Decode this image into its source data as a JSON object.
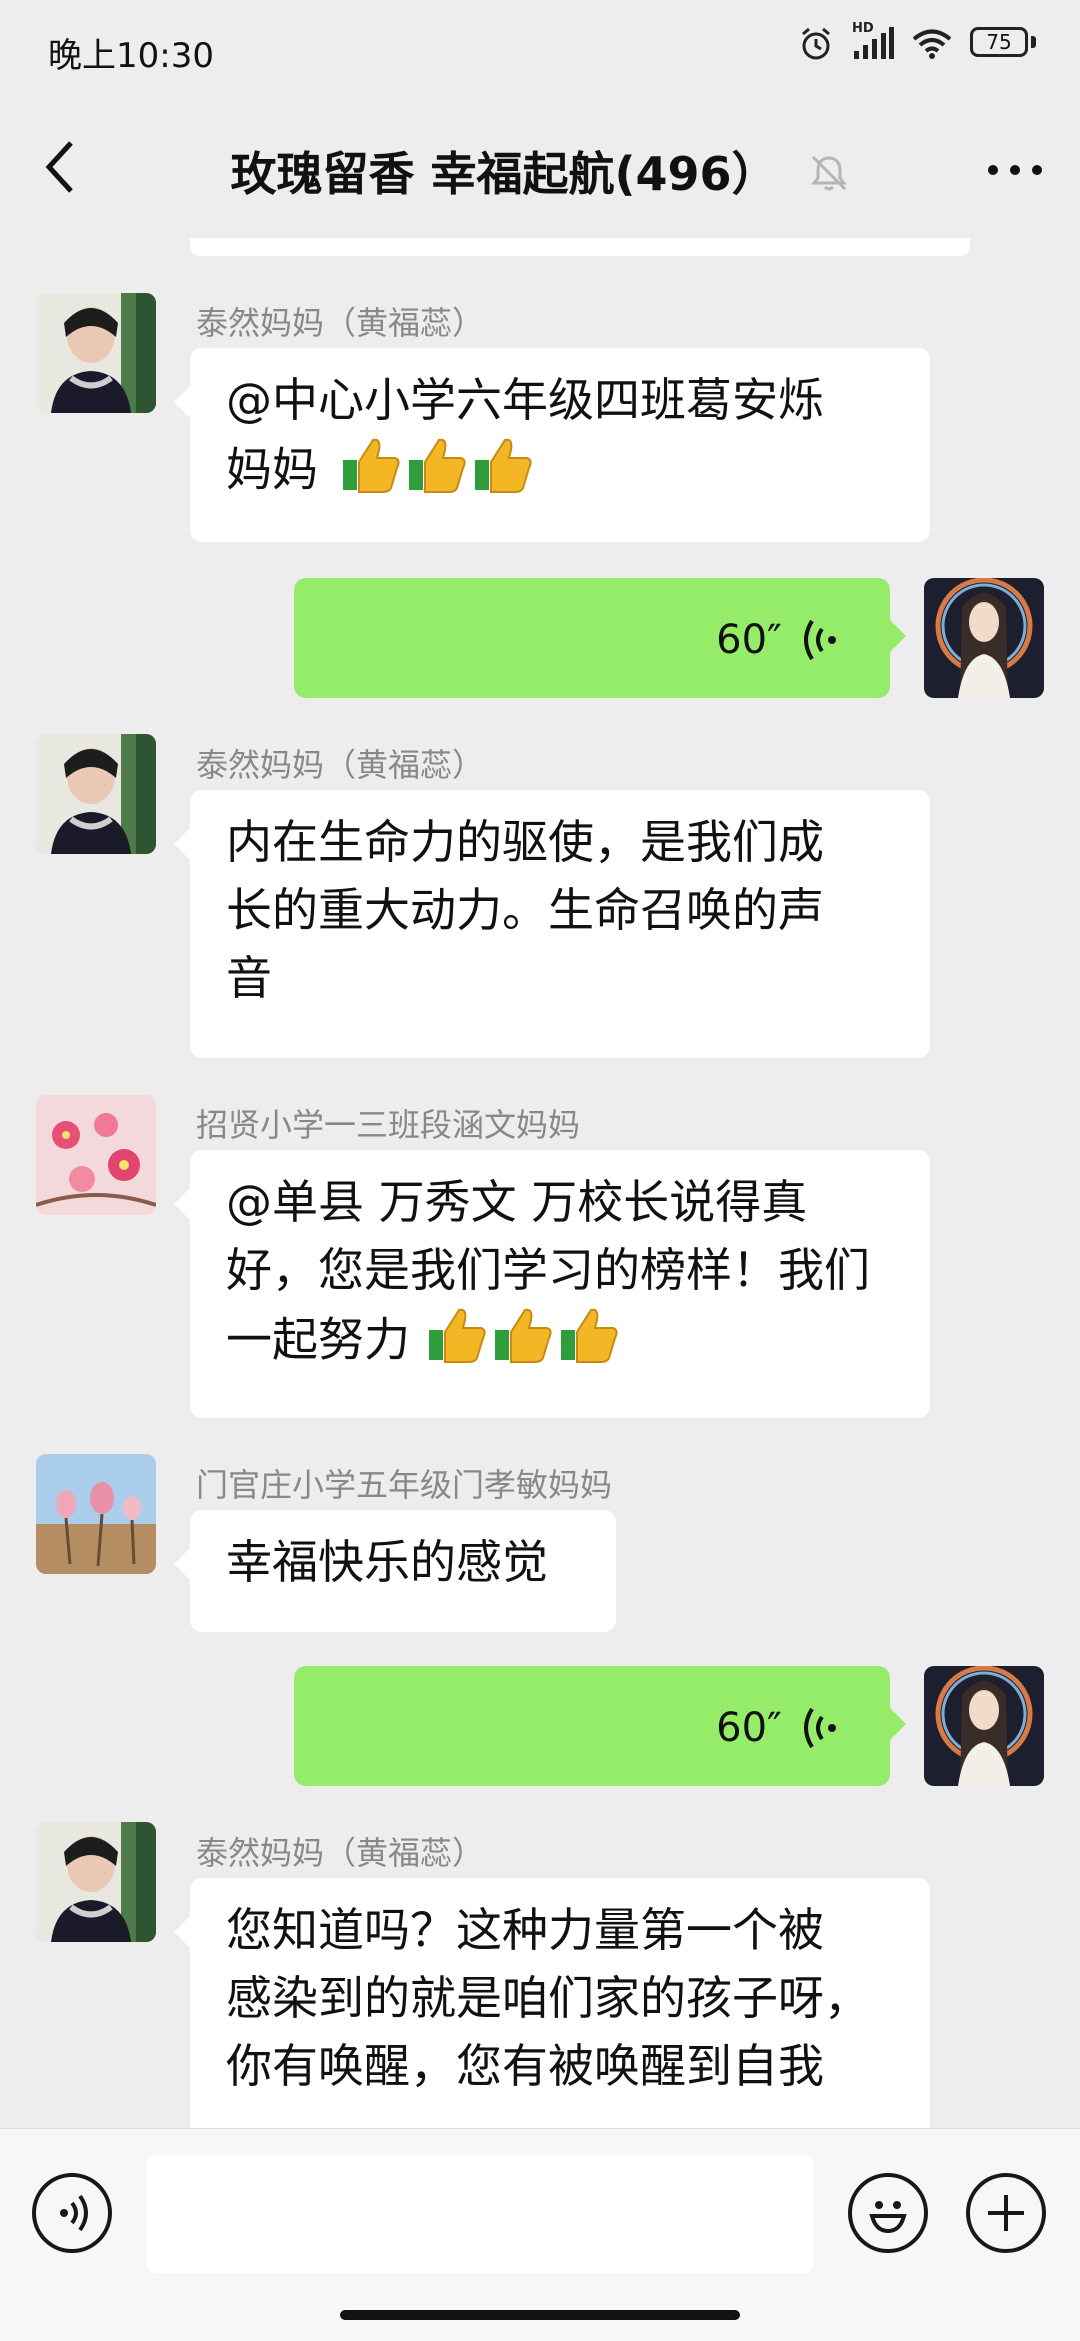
{
  "status_bar": {
    "time": "晚上10:30",
    "hd_label": "HD",
    "battery": "75",
    "icons": [
      "alarm-icon",
      "signal-icon",
      "wifi-icon",
      "battery-icon"
    ]
  },
  "header": {
    "title": "玫瑰留香  幸福起航(496）",
    "back_icon": "back-chevron-icon",
    "mute_icon": "muted-bell-icon",
    "more_icon": "more-dots-icon"
  },
  "messages": [
    {
      "type": "text",
      "side": "left",
      "sender": "泰然妈妈（黄福蕊）",
      "lines": [
        "@中心小学六年级四班葛安烁",
        "妈妈"
      ],
      "emoji": "thumbs-up-x3"
    },
    {
      "type": "voice",
      "side": "right",
      "duration": "60″"
    },
    {
      "type": "text",
      "side": "left",
      "sender": "泰然妈妈（黄福蕊）",
      "lines": [
        "内在生命力的驱使，是我们成",
        "长的重大动力。生命召唤的声",
        "音"
      ]
    },
    {
      "type": "text",
      "side": "left",
      "sender": "招贤小学一三班段涵文妈妈",
      "lines": [
        "@单县 万秀文  万校长说得真",
        "好，您是我们学习的榜样！我们",
        "一起努力"
      ],
      "emoji": "thumbs-up-x3"
    },
    {
      "type": "text",
      "side": "left",
      "sender": "门官庄小学五年级门孝敏妈妈",
      "lines": [
        "幸福快乐的感觉"
      ]
    },
    {
      "type": "voice",
      "side": "right",
      "duration": "60″"
    },
    {
      "type": "text",
      "side": "left",
      "sender": "泰然妈妈（黄福蕊）",
      "lines": [
        "您知道吗？这种力量第一个被",
        "感染到的就是咱们家的孩子呀，",
        "你有唤醒，您有被唤醒到自我"
      ]
    }
  ],
  "input_bar": {
    "placeholder": "",
    "voice_icon": "voice-input-icon",
    "emoji_icon": "emoji-icon",
    "plus_icon": "plus-icon"
  },
  "colors": {
    "background": "#ededed",
    "voice_bubble": "#95ec69",
    "text_bubble": "#ffffff",
    "sender_name": "#888888"
  }
}
